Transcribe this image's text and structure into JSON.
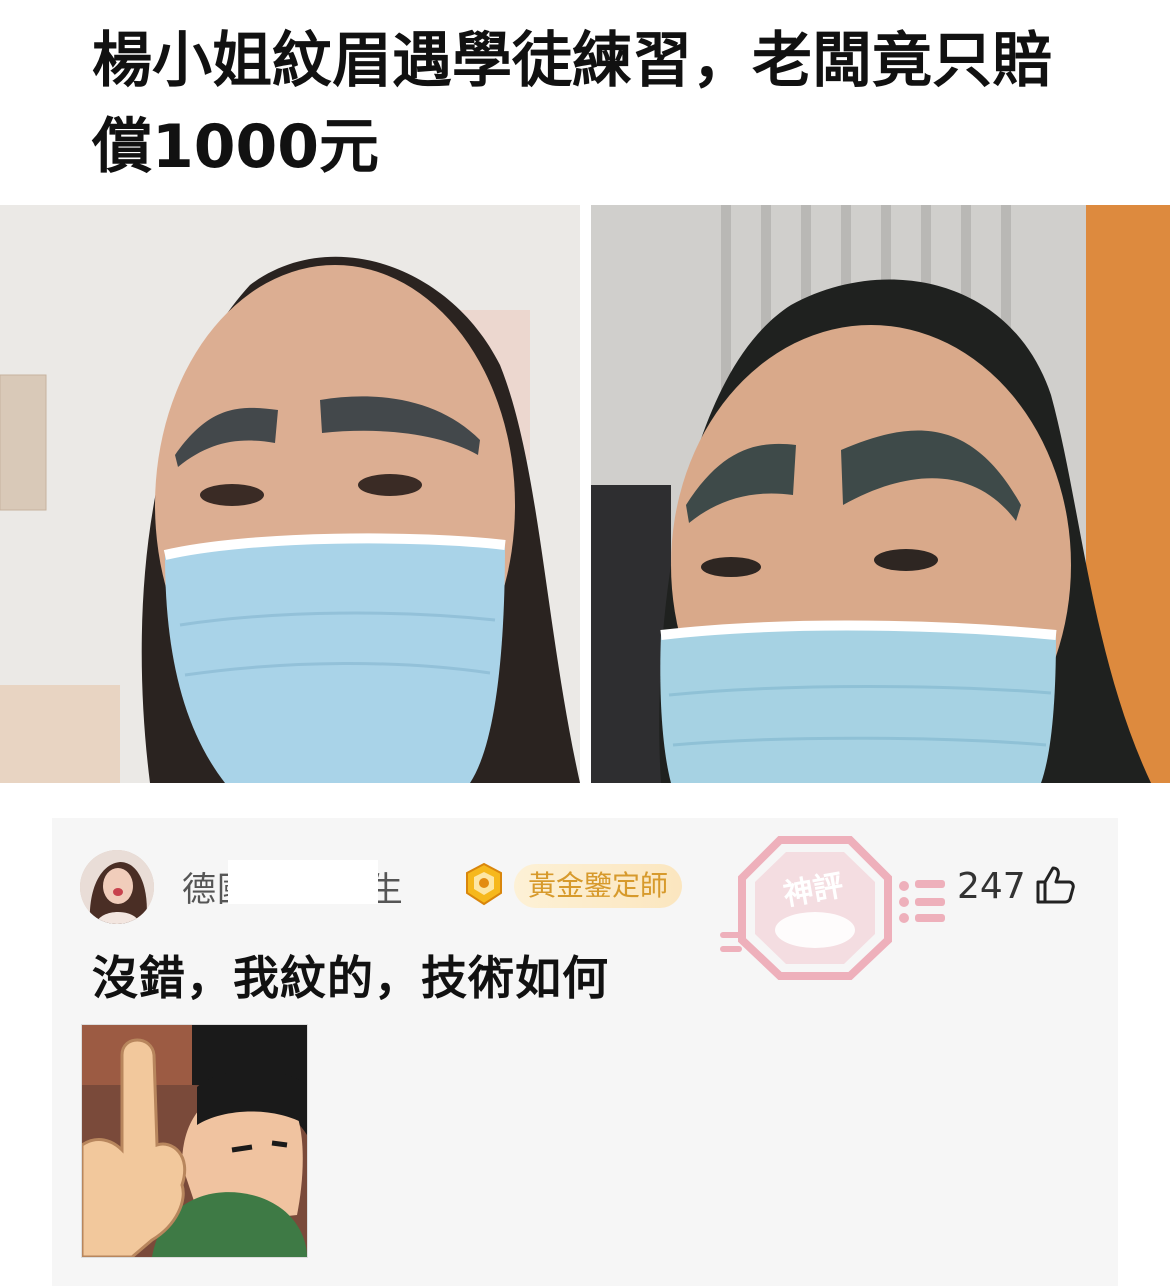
{
  "headline": "楊小姐紋眉遇學徒練習，老闆竟只賠償1000元",
  "photos": [
    {
      "name": "photo-left",
      "icon": "woman-masked-photo"
    },
    {
      "name": "photo-right",
      "icon": "woman-masked-photo"
    }
  ],
  "comment": {
    "username": "德國龍  美術生",
    "badge_label": "黃金鑒定師",
    "badge_icon": "gold-medal-icon",
    "stamp_text": "神評",
    "like_count": "247",
    "like_icon": "thumbs-up-icon",
    "text": "沒錯，我紋的，技術如何",
    "sticker_icon": "anime-thumbs-up-sticker"
  },
  "colors": {
    "badge_text": "#d79a2c",
    "stamp": "#e8a0ac",
    "card_bg": "#f6f6f6"
  }
}
